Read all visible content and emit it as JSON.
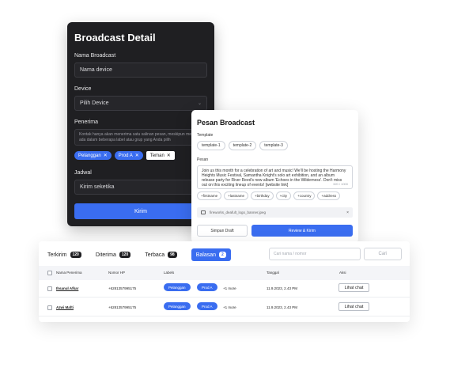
{
  "broadcast_detail": {
    "title": "Broadcast Detail",
    "nama_label": "Nama Broadcast",
    "nama_placeholder": "Nama device",
    "device_label": "Device",
    "device_value": "Pilih Device",
    "penerima_label": "Penerima",
    "penerima_note": "Kontak hanya akan menerima satu salinan pesan, meskipun mereka ada dalam beberapa label atau grup yang Anda pilih",
    "chips": [
      {
        "label": "Pelanggan",
        "remove": "✕"
      },
      {
        "label": "Prod A",
        "remove": "✕"
      },
      {
        "label": "Teman",
        "remove": "✕"
      }
    ],
    "jadwal_label": "Jadwal",
    "jadwal_value": "Kirim seketika",
    "submit_label": "Kirim"
  },
  "pesan_broadcast": {
    "title": "Pesan Broadcast",
    "template_label": "Template",
    "templates": [
      "template-1",
      "template-2",
      "template-3"
    ],
    "pesan_label": "Pesan",
    "message": "Join us this month for a celebration of art and music! We'll be hosting the Harmony Heights Music Festival, Samantha Knight's solo art exhibition, and an album release party for River Reed's new album 'Echoes in the Wilderness'. Don't miss out on this exciting lineup of events! [website link]",
    "char_count": "320 / 1000",
    "variables": [
      "+firstname",
      "+lastname",
      "+birthday",
      "+city",
      "+country",
      "+address"
    ],
    "attachment_name": "fireworks_deafult_logo_banner.jpeg",
    "attachment_remove": "×",
    "draft_label": "Simpan Draft",
    "send_label": "Review & Kirim"
  },
  "table": {
    "tabs": [
      {
        "label": "Terkirim",
        "count": "120"
      },
      {
        "label": "Diterima",
        "count": "120"
      },
      {
        "label": "Terbaca",
        "count": "98"
      },
      {
        "label": "Balasan",
        "count": "2"
      }
    ],
    "active_tab": "Balasan",
    "search_placeholder": "Cari nama / nomor",
    "search_button": "Cari",
    "headers": {
      "name": "Nama Penerima",
      "phone": "Nomor HP",
      "label": "Labels",
      "date": "Tanggal",
      "action": "Aksi"
    },
    "rows": [
      {
        "name": "Ihsanul Afkar",
        "phone": "+6281357995175",
        "labels": [
          "Pelanggan",
          "Prod A"
        ],
        "more": "+1 more",
        "date": "11.9.2023, 2.43 PM",
        "action": "Lihat chat"
      },
      {
        "name": "Azwi Mafti",
        "phone": "+6281357995175",
        "labels": [
          "Pelanggan",
          "Prod A"
        ],
        "more": "+1 more",
        "date": "11.9.2023, 2.43 PM",
        "action": "Lihat chat"
      }
    ]
  },
  "colors": {
    "accent": "#3a6df0",
    "dark_card": "#1f1f22"
  }
}
